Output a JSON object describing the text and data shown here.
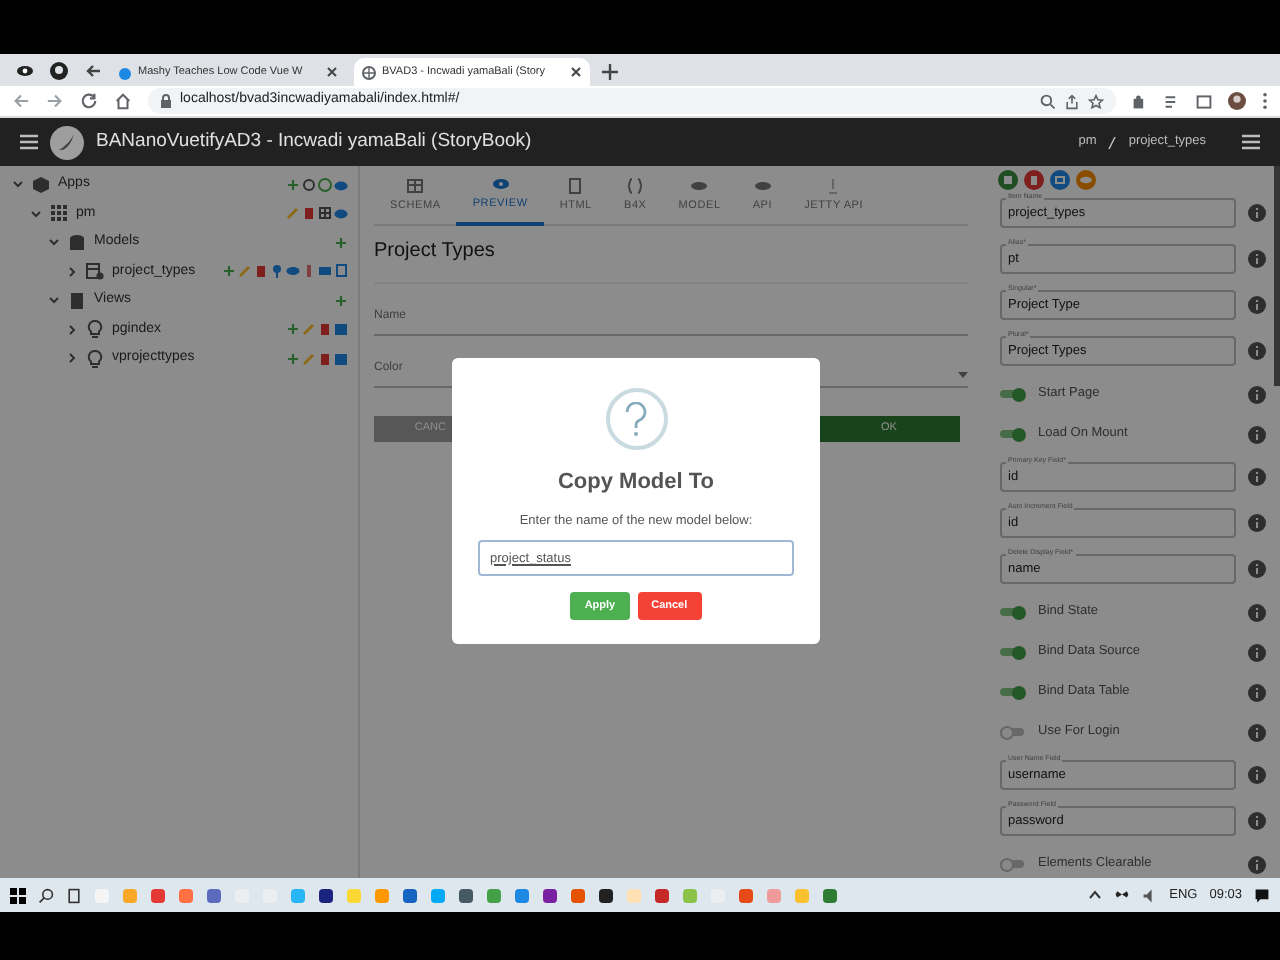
{
  "browser": {
    "tabs": [
      {
        "title": "Mashy Teaches Low Code Vue W",
        "selected": false
      },
      {
        "title": "BVAD3 - Incwadi yamaBali (Story",
        "selected": true
      }
    ],
    "url": "localhost/bvad3incwadiyamabali/index.html#/"
  },
  "app_bar": {
    "title": "BANanoVuetifyAD3 - Incwadi yamaBali (StoryBook)",
    "breadcrumbs": [
      "pm",
      "project_types"
    ]
  },
  "tree": [
    {
      "label": "Apps",
      "kind": "apps",
      "expanded": true,
      "children": [
        {
          "label": "pm",
          "kind": "project",
          "expanded": true,
          "children": [
            {
              "label": "Models",
              "kind": "models",
              "expanded": true,
              "children": [
                {
                  "label": "project_types",
                  "kind": "model",
                  "expanded": false
                }
              ]
            },
            {
              "label": "Views",
              "kind": "views",
              "expanded": true,
              "children": [
                {
                  "label": "pgindex",
                  "kind": "view",
                  "expanded": false
                },
                {
                  "label": "vprojecttypes",
                  "kind": "view",
                  "expanded": false
                }
              ]
            }
          ]
        }
      ]
    }
  ],
  "editor_tabs": [
    {
      "label": "SCHEMA",
      "selected": false
    },
    {
      "label": "PREVIEW",
      "selected": true
    },
    {
      "label": "HTML",
      "selected": false
    },
    {
      "label": "B4X",
      "selected": false
    },
    {
      "label": "MODEL",
      "selected": false
    },
    {
      "label": "API",
      "selected": false
    },
    {
      "label": "JETTY API",
      "selected": false
    }
  ],
  "preview": {
    "title": "Project Types",
    "fields": [
      {
        "label": "Name",
        "kind": "text"
      },
      {
        "label": "Color",
        "kind": "select"
      }
    ],
    "buttons": [
      "CANC",
      "OK"
    ]
  },
  "dialog": {
    "title": "Copy Model To",
    "message": "Enter the name of the new model below:",
    "value": "project_status",
    "buttons": [
      "Apply",
      "Cancel"
    ]
  },
  "properties": [
    {
      "kind": "field",
      "label": "Item Name",
      "value": "project_types"
    },
    {
      "kind": "field",
      "label": "Alias*",
      "value": "pt"
    },
    {
      "kind": "field",
      "label": "Singular*",
      "value": "Project Type"
    },
    {
      "kind": "field",
      "label": "Plural*",
      "value": "Project Types"
    },
    {
      "kind": "switch",
      "label": "Start Page",
      "on": true
    },
    {
      "kind": "switch",
      "label": "Load On Mount",
      "on": true
    },
    {
      "kind": "field",
      "label": "Primary Key Field*",
      "value": "id"
    },
    {
      "kind": "field",
      "label": "Auto Increment Field",
      "value": "id"
    },
    {
      "kind": "field",
      "label": "Delete Display Field*",
      "value": "name"
    },
    {
      "kind": "switch",
      "label": "Bind State",
      "on": true
    },
    {
      "kind": "switch",
      "label": "Bind Data Source",
      "on": true
    },
    {
      "kind": "switch",
      "label": "Bind Data Table",
      "on": true
    },
    {
      "kind": "switch",
      "label": "Use For Login",
      "on": false
    },
    {
      "kind": "field",
      "label": "User Name Field",
      "value": "username"
    },
    {
      "kind": "field",
      "label": "Password Field",
      "value": "password"
    },
    {
      "kind": "switch",
      "label": "Elements Clearable",
      "on": false
    }
  ],
  "taskbar": {
    "language": "ENG",
    "time": "09:03"
  }
}
